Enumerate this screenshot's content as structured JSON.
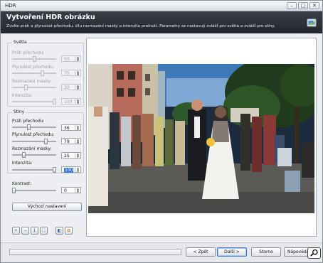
{
  "window": {
    "title": "HDR",
    "minimize_glyph": "–",
    "maximize_glyph": "□",
    "close_glyph": "✕"
  },
  "header": {
    "title": "Vytvoření HDR obrázku",
    "subtitle": "Zvolte práh a plynulost přechodu, sílu rozmazání masky a intenzitu prolnutí. Parametry se nastavují zvlášť pro světla a zvlášť pro stíny.",
    "icon": "hdr-tool-icon"
  },
  "lights": {
    "title": "Světla",
    "threshold": {
      "label": "Práh přechodu:",
      "value": "50",
      "level": 0.5
    },
    "smoothness": {
      "label": "Plynulost přechodu:",
      "value": "70",
      "level": 0.7
    },
    "blur": {
      "label": "Rozmazání masky:",
      "value": "30",
      "level": 0.3
    },
    "intensity": {
      "label": "Intenzita:",
      "value": "100",
      "level": 1.0
    }
  },
  "shadows": {
    "title": "Stíny",
    "threshold": {
      "label": "Práh přechodu:",
      "value": "36",
      "level": 0.36
    },
    "smoothness": {
      "label": "Plynulost přechodu:",
      "value": "79",
      "level": 0.79
    },
    "blur": {
      "label": "Rozmazání masky:",
      "value": "25",
      "level": 0.25
    },
    "intensity": {
      "label": "Intenzita:",
      "value": "100",
      "level": 1.0
    }
  },
  "contrast": {
    "label": "Kontrast:",
    "value": "0",
    "level": 0.0
  },
  "reset_button": "Výchozí nastavení",
  "toolbar": [
    "zoom-in-icon",
    "zoom-out-icon",
    "actual-size-icon",
    "fit-to-window-icon",
    "compare-icon",
    "settings-icon"
  ],
  "footer": {
    "back": "< Zpět",
    "next": "Další >",
    "cancel": "Storno",
    "help": "Nápověda"
  },
  "colors": {
    "header_bg": "#2b2f35",
    "selection": "#3377dd"
  }
}
